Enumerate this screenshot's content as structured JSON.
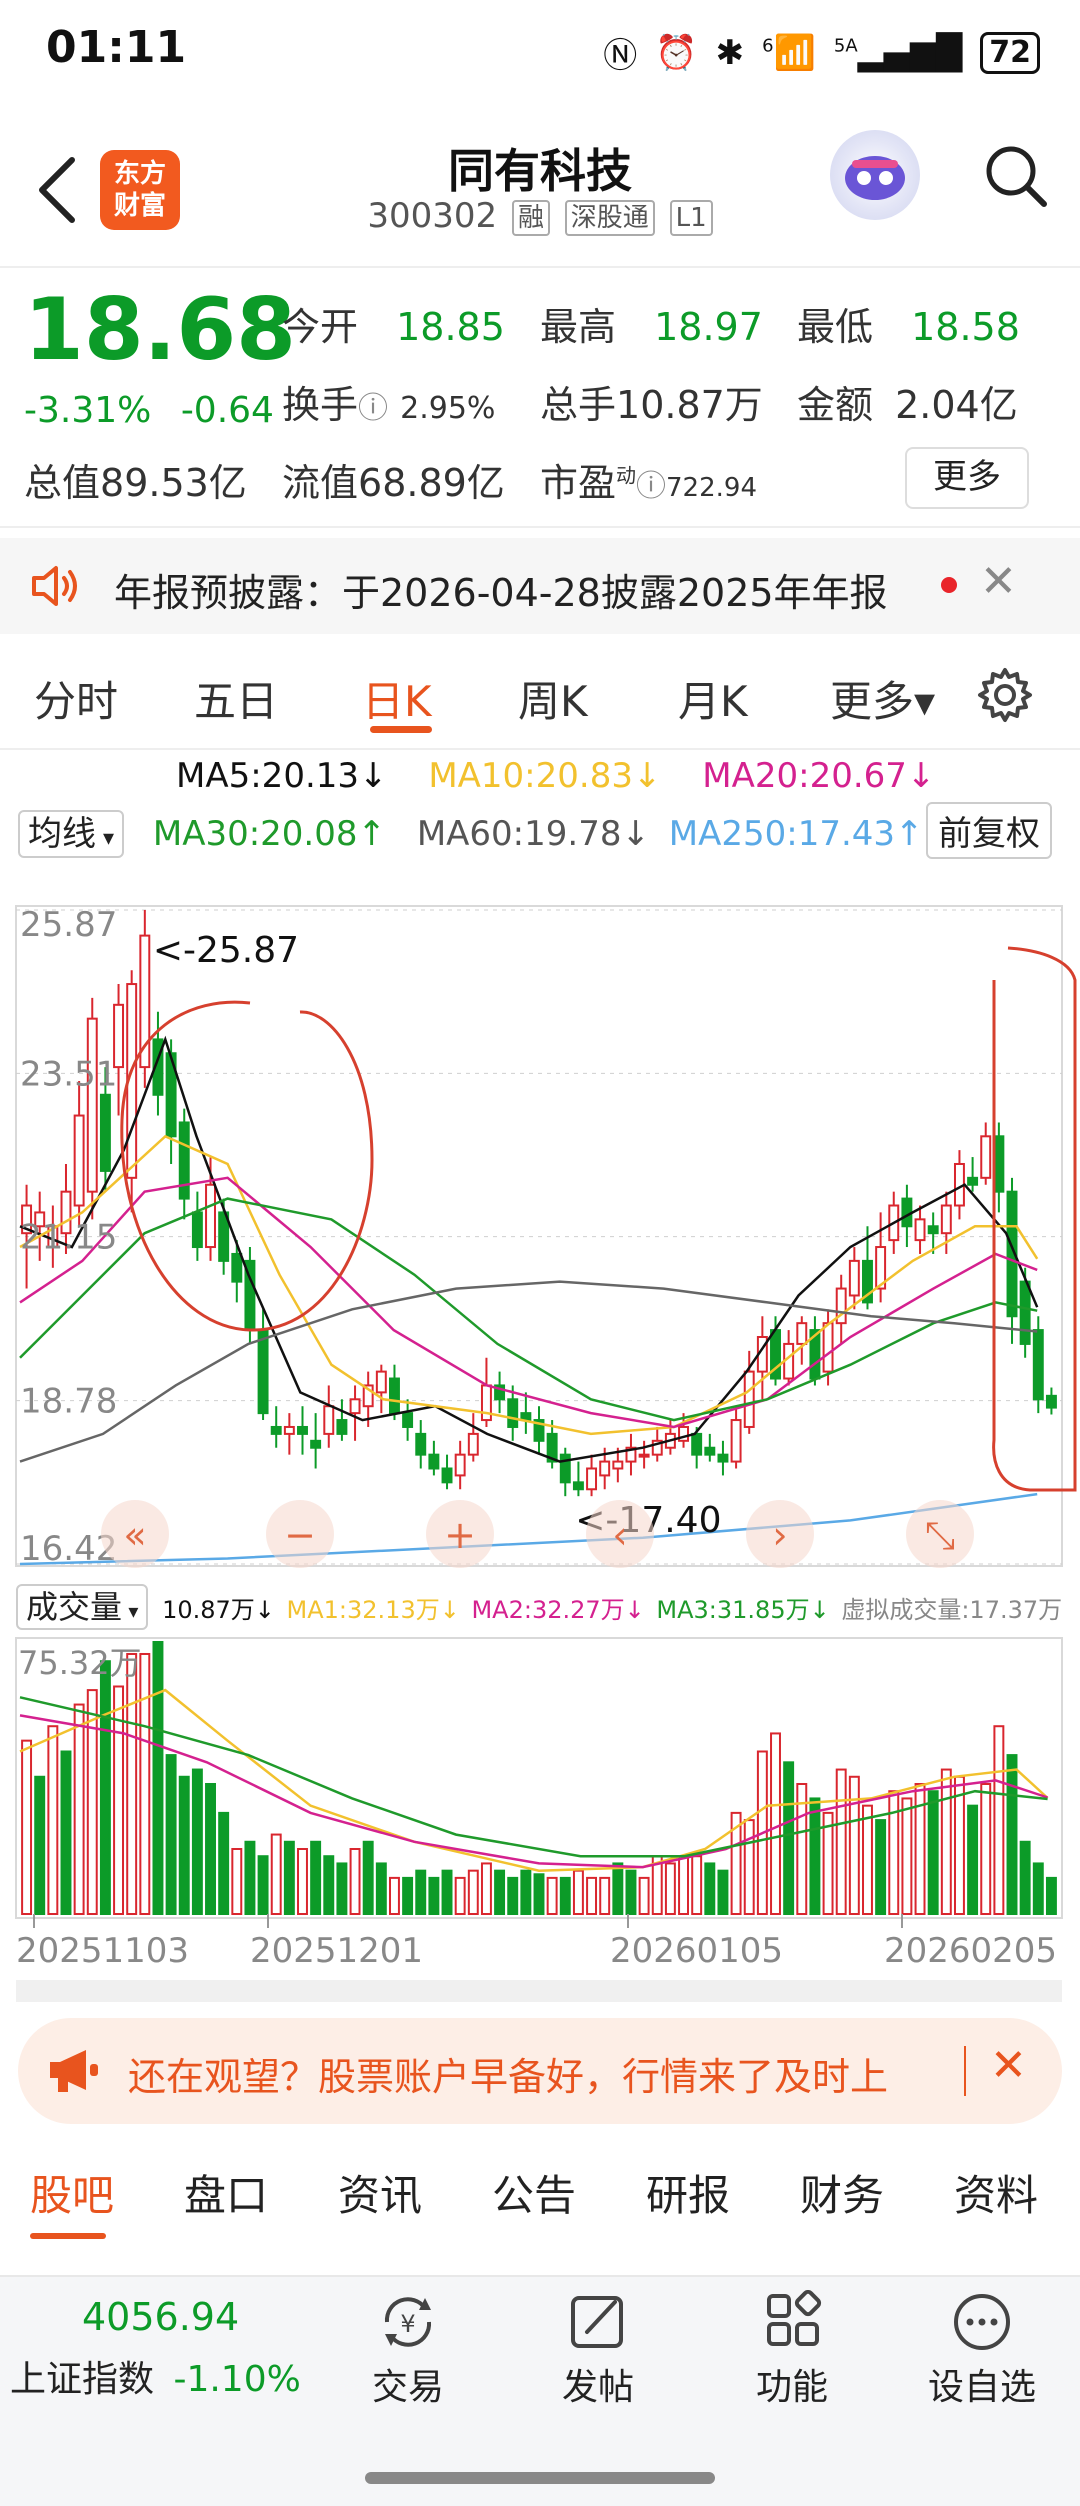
{
  "status_bar": {
    "time": "01:11",
    "signal": "5A",
    "wifi_badge": "6",
    "battery": "72"
  },
  "header": {
    "title": "同有科技",
    "code": "300302",
    "tags": [
      "融",
      "深股通",
      "L1"
    ],
    "logo_line1": "东方",
    "logo_line2": "财富"
  },
  "quote": {
    "price": "18.68",
    "change_pct": "-3.31%",
    "change": "-0.64",
    "open_label": "今开",
    "open": "18.85",
    "high_label": "最高",
    "high": "18.97",
    "low_label": "最低",
    "low": "18.58",
    "turnover_label": "换手",
    "turnover": "2.95%",
    "volume_label": "总手",
    "volume": "10.87万",
    "amount_label": "金额",
    "amount": "2.04亿",
    "mktcap_label": "总值",
    "mktcap": "89.53亿",
    "float_label": "流值",
    "float": "68.89亿",
    "pe_label": "市盈",
    "pe_sup": "动",
    "pe": "722.94",
    "more_label": "更多"
  },
  "notice": {
    "text": "年报预披露：于2026-04-28披露2025年年报"
  },
  "tabs": [
    "分时",
    "五日",
    "日K",
    "周K",
    "月K",
    "更多▾"
  ],
  "active_tab": "日K",
  "ma": {
    "selector": "均线",
    "ma5": "MA5:20.13↓",
    "ma10": "MA10:20.83↓",
    "ma20": "MA20:20.67↓",
    "ma30": "MA30:20.08↑",
    "ma60": "MA60:19.78↓",
    "ma250": "MA250:17.43↑",
    "adjust": "前复权",
    "colors": {
      "ma5": "#111111",
      "ma10": "#f2c12e",
      "ma20": "#d4218f",
      "ma30": "#1f9a2b",
      "ma60": "#666666",
      "ma250": "#5aa9e6"
    }
  },
  "chart_data": {
    "type": "candlestick",
    "y_ticks": [
      "25.87",
      "23.51",
      "21.15",
      "18.78",
      "16.42"
    ],
    "ylim": [
      16.42,
      25.87
    ],
    "high_annotation": "<-25.87",
    "low_annotation": "<-17.40",
    "x_labels": [
      "20251103",
      "20251201",
      "20260105",
      "20260205"
    ],
    "candles": [
      [
        21.2,
        21.6,
        20.4,
        21.9
      ],
      [
        21.3,
        21.5,
        20.8,
        21.8
      ],
      [
        21.0,
        21.3,
        20.7,
        21.6
      ],
      [
        21.2,
        21.8,
        20.9,
        22.2
      ],
      [
        21.6,
        22.9,
        21.3,
        23.4
      ],
      [
        21.8,
        24.3,
        21.4,
        24.6
      ],
      [
        23.2,
        22.1,
        21.8,
        23.6
      ],
      [
        23.6,
        24.5,
        22.9,
        24.8
      ],
      [
        22.0,
        24.8,
        21.5,
        25.0
      ],
      [
        23.6,
        25.5,
        23.3,
        25.87
      ],
      [
        24.0,
        23.2,
        22.9,
        24.4
      ],
      [
        23.8,
        22.6,
        22.2,
        24.0
      ],
      [
        22.8,
        21.7,
        21.4,
        23.0
      ],
      [
        21.5,
        21.0,
        20.8,
        21.8
      ],
      [
        21.0,
        21.9,
        20.8,
        22.3
      ],
      [
        21.5,
        20.8,
        20.6,
        21.7
      ],
      [
        20.9,
        20.5,
        20.2,
        21.1
      ],
      [
        20.8,
        19.8,
        19.6,
        21.0
      ],
      [
        19.8,
        18.6,
        18.5,
        20.1
      ],
      [
        18.4,
        18.3,
        18.1,
        18.7
      ],
      [
        18.3,
        18.4,
        18.0,
        18.6
      ],
      [
        18.4,
        18.3,
        18.0,
        18.7
      ],
      [
        18.2,
        18.1,
        17.8,
        18.6
      ],
      [
        18.3,
        18.7,
        18.1,
        19.0
      ],
      [
        18.5,
        18.3,
        18.2,
        18.8
      ],
      [
        18.6,
        18.8,
        18.2,
        19.0
      ],
      [
        18.7,
        19.0,
        18.4,
        19.2
      ],
      [
        18.9,
        19.2,
        18.6,
        19.3
      ],
      [
        19.1,
        18.6,
        18.5,
        19.3
      ],
      [
        18.6,
        18.4,
        18.2,
        18.8
      ],
      [
        18.3,
        18.0,
        17.8,
        18.5
      ],
      [
        18.0,
        17.8,
        17.7,
        18.2
      ],
      [
        17.8,
        17.6,
        17.5,
        18.0
      ],
      [
        17.7,
        18.0,
        17.5,
        18.2
      ],
      [
        18.0,
        18.3,
        17.9,
        18.6
      ],
      [
        18.5,
        19.0,
        18.4,
        19.4
      ],
      [
        19.0,
        18.8,
        18.6,
        19.2
      ],
      [
        18.8,
        18.4,
        18.2,
        19.0
      ],
      [
        18.6,
        18.5,
        18.3,
        18.9
      ],
      [
        18.5,
        18.2,
        18.0,
        18.7
      ],
      [
        18.3,
        17.9,
        17.8,
        18.5
      ],
      [
        18.0,
        17.6,
        17.4,
        18.1
      ],
      [
        17.6,
        17.5,
        17.4,
        17.9
      ],
      [
        17.5,
        17.8,
        17.4,
        18.0
      ],
      [
        17.7,
        17.9,
        17.5,
        18.1
      ],
      [
        17.8,
        17.9,
        17.6,
        18.1
      ],
      [
        17.9,
        18.1,
        17.7,
        18.3
      ],
      [
        18.0,
        18.0,
        17.8,
        18.2
      ],
      [
        18.0,
        18.2,
        17.9,
        18.4
      ],
      [
        18.1,
        18.3,
        18.0,
        18.5
      ],
      [
        18.2,
        18.4,
        18.1,
        18.6
      ],
      [
        18.3,
        18.0,
        17.8,
        18.4
      ],
      [
        18.1,
        18.0,
        17.9,
        18.3
      ],
      [
        18.0,
        17.9,
        17.7,
        18.2
      ],
      [
        17.9,
        18.5,
        17.8,
        18.7
      ],
      [
        18.4,
        19.2,
        18.3,
        19.5
      ],
      [
        19.2,
        19.7,
        18.8,
        20.0
      ],
      [
        19.8,
        19.1,
        19.0,
        20.0
      ],
      [
        19.1,
        19.6,
        19.0,
        19.8
      ],
      [
        19.6,
        19.9,
        19.3,
        20.0
      ],
      [
        19.8,
        19.1,
        19.0,
        20.0
      ],
      [
        19.2,
        19.9,
        19.0,
        20.1
      ],
      [
        19.9,
        20.4,
        19.6,
        20.6
      ],
      [
        20.3,
        20.8,
        20.1,
        21.0
      ],
      [
        20.8,
        20.2,
        20.1,
        21.3
      ],
      [
        20.4,
        21.0,
        20.2,
        21.5
      ],
      [
        21.1,
        21.6,
        20.9,
        21.8
      ],
      [
        21.7,
        21.3,
        21.0,
        21.9
      ],
      [
        21.1,
        21.4,
        20.9,
        21.6
      ],
      [
        21.3,
        21.2,
        20.9,
        21.5
      ],
      [
        21.2,
        21.6,
        20.9,
        21.8
      ],
      [
        21.6,
        22.2,
        21.4,
        22.4
      ],
      [
        22.0,
        21.9,
        21.8,
        22.3
      ],
      [
        22.0,
        22.6,
        21.9,
        22.8
      ],
      [
        22.6,
        21.8,
        21.5,
        22.8
      ],
      [
        21.8,
        20.0,
        19.6,
        22.0
      ],
      [
        20.5,
        19.6,
        19.4,
        20.7
      ],
      [
        19.8,
        18.8,
        18.6,
        20.0
      ],
      [
        18.85,
        18.68,
        18.58,
        18.97
      ]
    ],
    "ma_series": {
      "ma5": [
        [
          0,
          21.3
        ],
        [
          0.05,
          21.0
        ],
        [
          0.1,
          22.4
        ],
        [
          0.14,
          24.0
        ],
        [
          0.17,
          22.6
        ],
        [
          0.22,
          20.6
        ],
        [
          0.27,
          18.9
        ],
        [
          0.33,
          18.5
        ],
        [
          0.4,
          18.7
        ],
        [
          0.45,
          18.3
        ],
        [
          0.52,
          17.9
        ],
        [
          0.6,
          18.1
        ],
        [
          0.65,
          18.3
        ],
        [
          0.7,
          19.2
        ],
        [
          0.75,
          20.3
        ],
        [
          0.8,
          21.0
        ],
        [
          0.86,
          21.5
        ],
        [
          0.91,
          21.9
        ],
        [
          0.95,
          21.2
        ],
        [
          0.98,
          20.13
        ]
      ],
      "ma10": [
        [
          0,
          21.0
        ],
        [
          0.06,
          21.5
        ],
        [
          0.14,
          22.6
        ],
        [
          0.2,
          22.2
        ],
        [
          0.25,
          20.6
        ],
        [
          0.3,
          19.3
        ],
        [
          0.35,
          18.8
        ],
        [
          0.45,
          18.6
        ],
        [
          0.55,
          18.3
        ],
        [
          0.63,
          18.4
        ],
        [
          0.7,
          18.9
        ],
        [
          0.78,
          19.9
        ],
        [
          0.86,
          20.8
        ],
        [
          0.92,
          21.3
        ],
        [
          0.96,
          21.3
        ],
        [
          0.98,
          20.83
        ]
      ],
      "ma20": [
        [
          0,
          20.2
        ],
        [
          0.06,
          20.8
        ],
        [
          0.12,
          21.8
        ],
        [
          0.2,
          22.0
        ],
        [
          0.28,
          21.0
        ],
        [
          0.36,
          19.8
        ],
        [
          0.45,
          19.0
        ],
        [
          0.55,
          18.6
        ],
        [
          0.63,
          18.4
        ],
        [
          0.72,
          18.8
        ],
        [
          0.8,
          19.7
        ],
        [
          0.88,
          20.4
        ],
        [
          0.94,
          20.9
        ],
        [
          0.98,
          20.67
        ]
      ],
      "ma30": [
        [
          0,
          19.4
        ],
        [
          0.06,
          20.3
        ],
        [
          0.12,
          21.2
        ],
        [
          0.2,
          21.7
        ],
        [
          0.3,
          21.4
        ],
        [
          0.38,
          20.6
        ],
        [
          0.46,
          19.6
        ],
        [
          0.55,
          18.8
        ],
        [
          0.63,
          18.5
        ],
        [
          0.72,
          18.8
        ],
        [
          0.8,
          19.3
        ],
        [
          0.88,
          19.9
        ],
        [
          0.94,
          20.2
        ],
        [
          0.98,
          20.08
        ]
      ],
      "ma60": [
        [
          0,
          17.9
        ],
        [
          0.08,
          18.3
        ],
        [
          0.15,
          19.0
        ],
        [
          0.22,
          19.6
        ],
        [
          0.32,
          20.1
        ],
        [
          0.42,
          20.4
        ],
        [
          0.52,
          20.5
        ],
        [
          0.62,
          20.4
        ],
        [
          0.72,
          20.2
        ],
        [
          0.82,
          20.0
        ],
        [
          0.9,
          19.9
        ],
        [
          0.98,
          19.78
        ]
      ],
      "ma250": [
        [
          0,
          16.42
        ],
        [
          0.2,
          16.5
        ],
        [
          0.4,
          16.65
        ],
        [
          0.6,
          16.8
        ],
        [
          0.8,
          17.05
        ],
        [
          0.98,
          17.43
        ]
      ]
    },
    "volume": {
      "selector": "成交量",
      "summary": "10.87万↓",
      "ma1": "MA1:32.13万↓",
      "ma2": "MA2:32.27万↓",
      "ma3": "MA3:31.85万↓",
      "virtual": "虚拟成交量:17.37万",
      "max_label": "75.32万",
      "ylim": [
        0,
        75.32
      ],
      "bars": [
        [
          48,
          1
        ],
        [
          38,
          0
        ],
        [
          52,
          1
        ],
        [
          45,
          0
        ],
        [
          58,
          1
        ],
        [
          62,
          1
        ],
        [
          70,
          0
        ],
        [
          63,
          1
        ],
        [
          72,
          1
        ],
        [
          72,
          1
        ],
        [
          75.32,
          0
        ],
        [
          44,
          0
        ],
        [
          38,
          0
        ],
        [
          40,
          0
        ],
        [
          36,
          0
        ],
        [
          28,
          0
        ],
        [
          18,
          1
        ],
        [
          20,
          0
        ],
        [
          16,
          0
        ],
        [
          22,
          1
        ],
        [
          20,
          0
        ],
        [
          18,
          1
        ],
        [
          20,
          0
        ],
        [
          16,
          0
        ],
        [
          14,
          0
        ],
        [
          18,
          1
        ],
        [
          20,
          0
        ],
        [
          14,
          0
        ],
        [
          10,
          1
        ],
        [
          10,
          0
        ],
        [
          12,
          0
        ],
        [
          10,
          0
        ],
        [
          12,
          0
        ],
        [
          10,
          1
        ],
        [
          12,
          1
        ],
        [
          14,
          1
        ],
        [
          12,
          0
        ],
        [
          10,
          0
        ],
        [
          12,
          0
        ],
        [
          11,
          0
        ],
        [
          10,
          1
        ],
        [
          10,
          0
        ],
        [
          12,
          1
        ],
        [
          10,
          1
        ],
        [
          10,
          1
        ],
        [
          14,
          0
        ],
        [
          12,
          0
        ],
        [
          10,
          1
        ],
        [
          16,
          1
        ],
        [
          14,
          1
        ],
        [
          16,
          1
        ],
        [
          16,
          1
        ],
        [
          14,
          0
        ],
        [
          12,
          0
        ],
        [
          28,
          1
        ],
        [
          26,
          1
        ],
        [
          45,
          1
        ],
        [
          50,
          1
        ],
        [
          42,
          0
        ],
        [
          36,
          1
        ],
        [
          32,
          0
        ],
        [
          28,
          1
        ],
        [
          40,
          1
        ],
        [
          38,
          1
        ],
        [
          30,
          1
        ],
        [
          26,
          0
        ],
        [
          34,
          1
        ],
        [
          32,
          1
        ],
        [
          36,
          1
        ],
        [
          34,
          0
        ],
        [
          40,
          1
        ],
        [
          38,
          1
        ],
        [
          30,
          0
        ],
        [
          36,
          1
        ],
        [
          52,
          1
        ],
        [
          44,
          0
        ],
        [
          20,
          0
        ],
        [
          14,
          0
        ],
        [
          10,
          0
        ]
      ],
      "ma_series": {
        "ma1": [
          [
            0,
            45
          ],
          [
            0.08,
            55
          ],
          [
            0.14,
            62
          ],
          [
            0.2,
            48
          ],
          [
            0.28,
            30
          ],
          [
            0.38,
            20
          ],
          [
            0.5,
            12
          ],
          [
            0.6,
            13
          ],
          [
            0.66,
            18
          ],
          [
            0.72,
            30
          ],
          [
            0.82,
            32
          ],
          [
            0.9,
            38
          ],
          [
            0.96,
            40
          ],
          [
            0.99,
            32.13
          ]
        ],
        "ma2": [
          [
            0,
            55
          ],
          [
            0.1,
            50
          ],
          [
            0.18,
            42
          ],
          [
            0.28,
            28
          ],
          [
            0.38,
            20
          ],
          [
            0.5,
            14
          ],
          [
            0.6,
            13
          ],
          [
            0.68,
            18
          ],
          [
            0.76,
            28
          ],
          [
            0.86,
            34
          ],
          [
            0.94,
            37
          ],
          [
            0.99,
            32.27
          ]
        ],
        "ma3": [
          [
            0,
            60
          ],
          [
            0.12,
            52
          ],
          [
            0.22,
            44
          ],
          [
            0.32,
            32
          ],
          [
            0.42,
            22
          ],
          [
            0.54,
            16
          ],
          [
            0.64,
            16
          ],
          [
            0.74,
            22
          ],
          [
            0.84,
            28
          ],
          [
            0.92,
            34
          ],
          [
            0.99,
            31.85
          ]
        ]
      }
    }
  },
  "chart_controls": [
    "«",
    "−",
    "+",
    "‹",
    "›",
    "⤡"
  ],
  "ad": {
    "text": "还在观望？股票账户早备好，行情来了及时上"
  },
  "subtabs": [
    "股吧",
    "盘口",
    "资讯",
    "公告",
    "研报",
    "财务",
    "资料"
  ],
  "active_subtab": "股吧",
  "bottom": {
    "index_value": "4056.94",
    "index_name": "上证指数",
    "index_change": "-1.10%",
    "nav": [
      {
        "label": "交易",
        "icon": "yen-cycle-icon"
      },
      {
        "label": "发帖",
        "icon": "edit-icon"
      },
      {
        "label": "功能",
        "icon": "grid-icon"
      },
      {
        "label": "设自选",
        "icon": "more-dots-icon"
      }
    ]
  },
  "colors": {
    "up": "#d9262e",
    "down": "#0c9b28",
    "accent": "#e8541e"
  }
}
